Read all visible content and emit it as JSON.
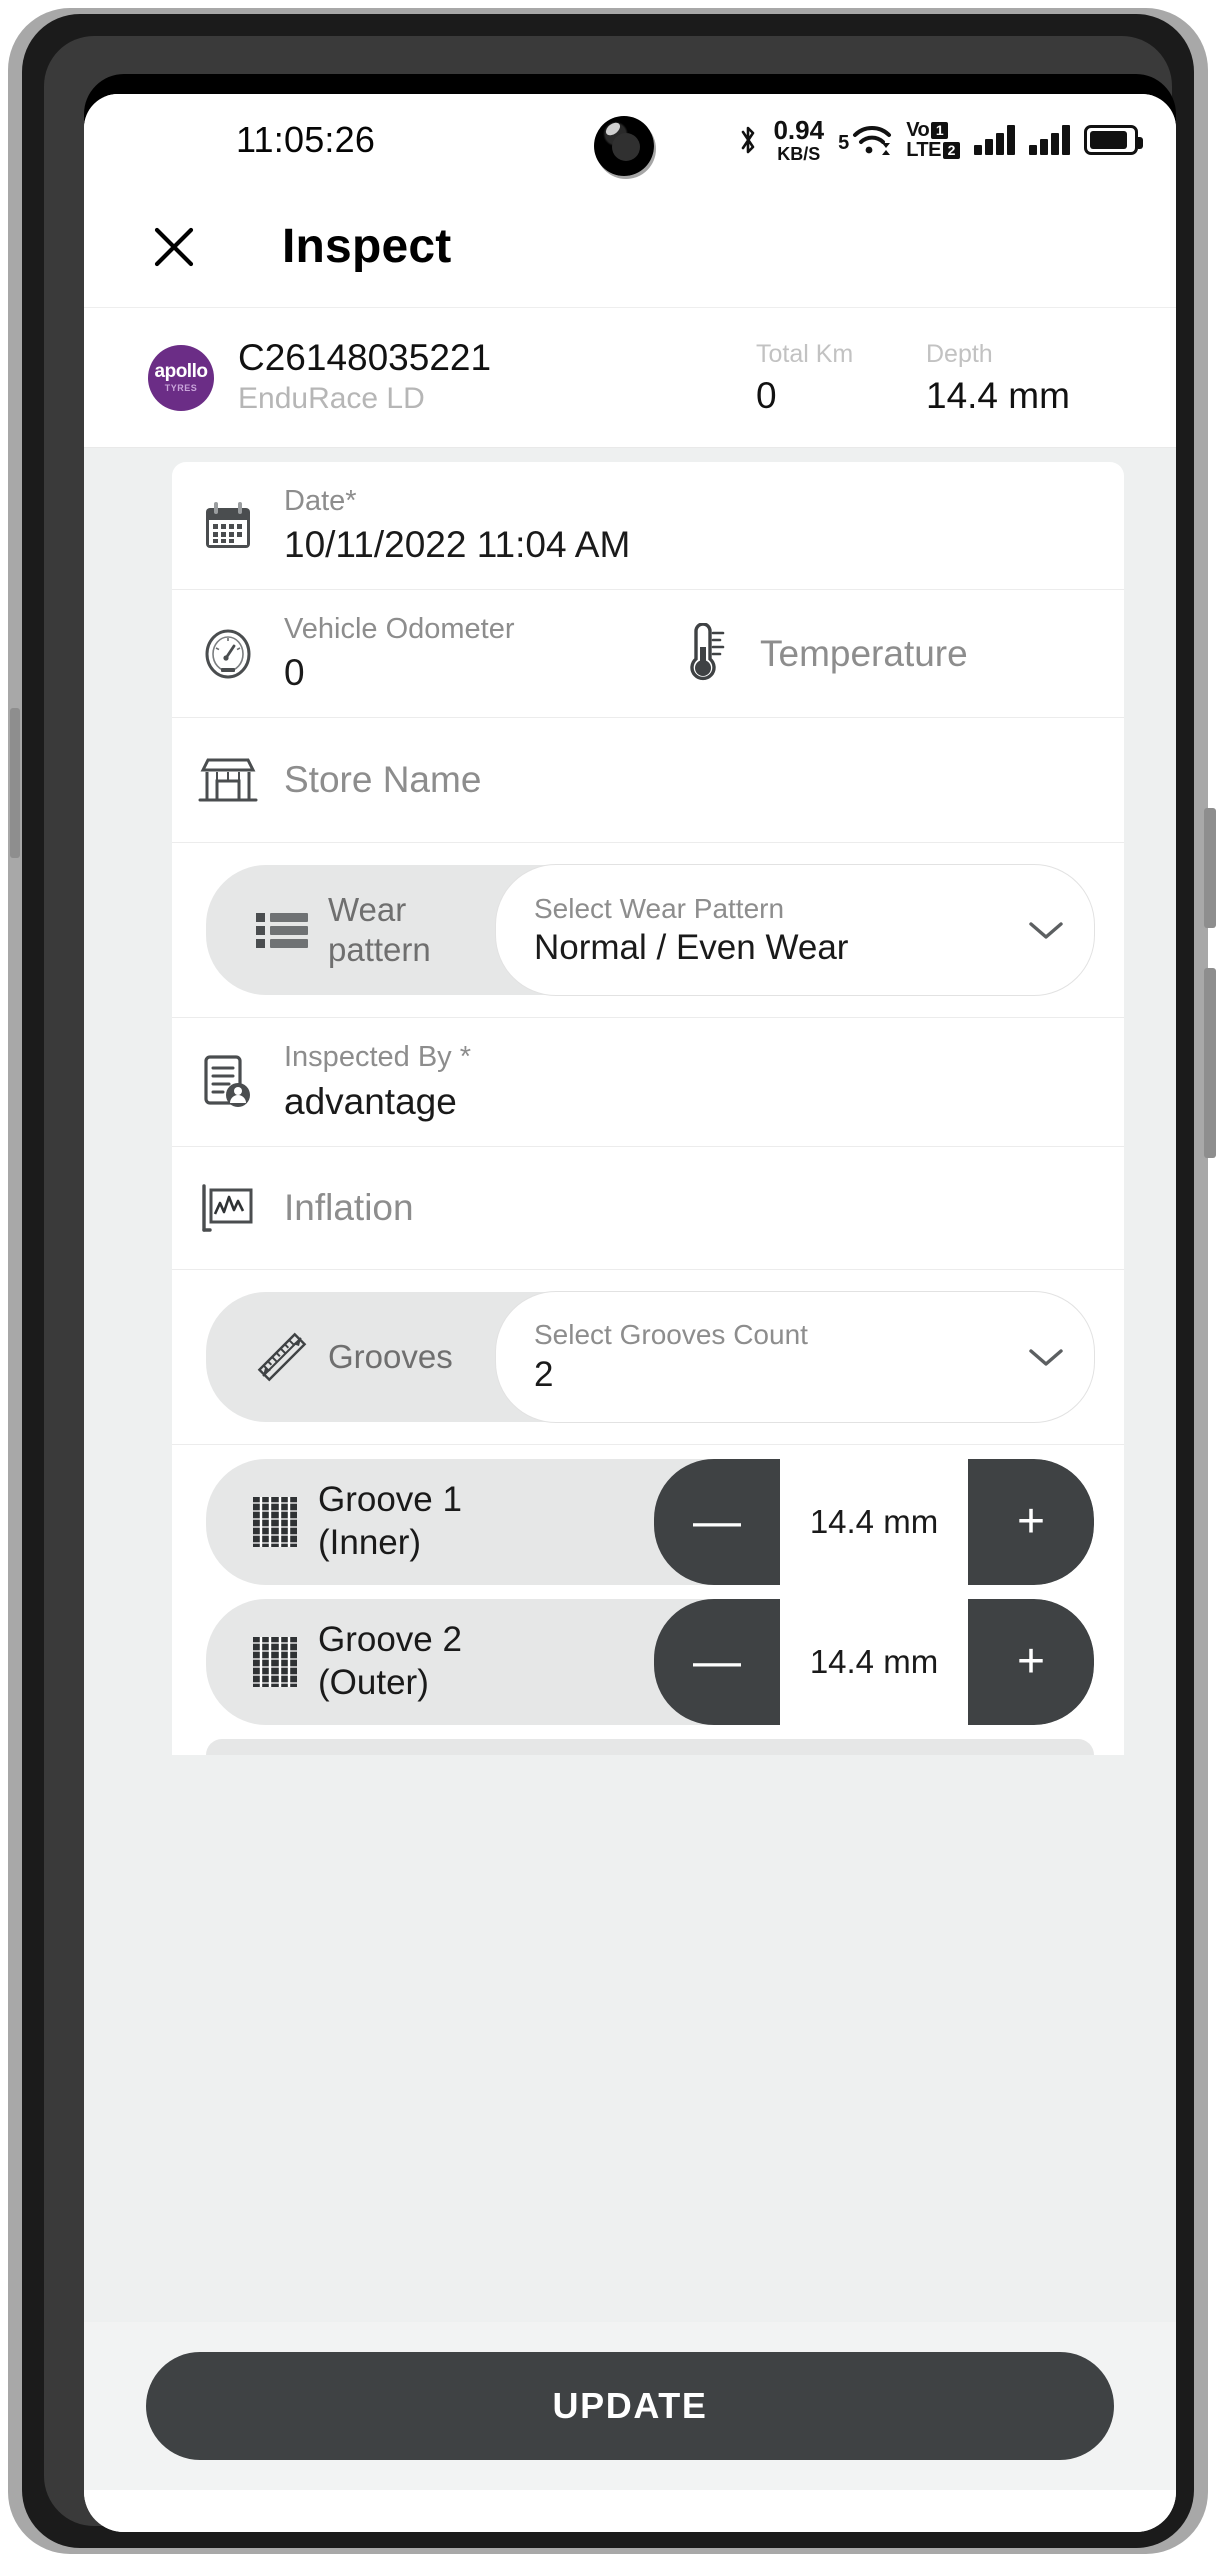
{
  "status_bar": {
    "clock": "11:05:26",
    "net_speed_value": "0.94",
    "net_speed_unit": "KB/S",
    "wifi_sim": "5",
    "volte_top": "Vo",
    "volte_bottom": "LTE",
    "volte_badge_top": "1",
    "volte_badge_bottom": "2",
    "icons": [
      "camera-icon",
      "bluetooth-icon",
      "wifi-icon",
      "volte-icon",
      "signal-bars-icon",
      "signal-bars-icon",
      "battery-icon"
    ]
  },
  "appbar": {
    "close_label": "✕",
    "title": "Inspect"
  },
  "tire_summary": {
    "brand_line1": "apollo",
    "brand_line2": "TYRES",
    "tire_id": "C26148035221",
    "tire_model": "EnduRace LD",
    "total_km_label": "Total Km",
    "total_km_value": "0",
    "depth_label": "Depth",
    "depth_value": "14.4 mm"
  },
  "form": {
    "date": {
      "label": "Date*",
      "value": "10/11/2022 11:04 AM",
      "icon": "calendar-icon"
    },
    "odometer": {
      "label": "Vehicle Odometer",
      "value": "0",
      "icon": "speedometer-icon"
    },
    "temperature": {
      "placeholder": "Temperature",
      "icon": "thermometer-icon"
    },
    "store": {
      "placeholder": "Store Name",
      "icon": "store-icon"
    },
    "wear_pattern": {
      "label": "Wear pattern",
      "select_hint": "Select Wear Pattern",
      "select_value": "Normal / Even Wear",
      "icon": "list-icon",
      "chevron": "chevron-down-icon"
    },
    "inspected_by": {
      "label": "Inspected By *",
      "value": "advantage",
      "icon": "document-user-icon"
    },
    "inflation": {
      "placeholder": "Inflation",
      "icon": "chart-icon"
    },
    "grooves": {
      "label": "Grooves",
      "select_hint": "Select Grooves Count",
      "select_value": "2",
      "icon": "ruler-icon",
      "chevron": "chevron-down-icon"
    },
    "groove_rows": [
      {
        "label": "Groove 1 (Inner)",
        "value": "14.4 mm",
        "minus": "—",
        "plus": "+",
        "icon": "tire-tread-icon"
      },
      {
        "label": "Groove 2 (Outer)",
        "value": "14.4 mm",
        "minus": "—",
        "plus": "+",
        "icon": "tire-tread-icon"
      }
    ]
  },
  "bottom": {
    "update_label": "UPDATE"
  },
  "colors": {
    "brand_purple": "#6b2d86",
    "dark_button": "#3f4244",
    "pill_grey": "#e6e7e7",
    "page_grey": "#eef0f0",
    "muted_text": "#8d8d8d"
  }
}
